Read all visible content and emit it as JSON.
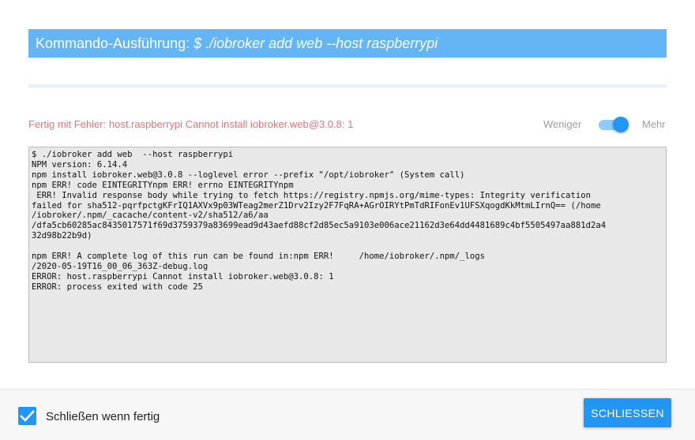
{
  "dialog": {
    "title_prefix": "Kommando-Ausführung: ",
    "title_command": "$ ./iobroker add web --host raspberrypi",
    "status": "Fertig mit Fehler: host.raspberrypi Cannot install iobroker.web@3.0.8: 1",
    "toggle": {
      "left_label": "Weniger",
      "right_label": "Mehr",
      "state": "on"
    },
    "log_lines": [
      "$ ./iobroker add web  --host raspberrypi",
      "NPM version: 6.14.4",
      "npm install iobroker.web@3.0.8 --loglevel error --prefix \"/opt/iobroker\" (System call)",
      "npm ERR! code EINTEGRITYnpm ERR! errno EINTEGRITYnpm",
      " ERR! Invalid response body while trying to fetch https://registry.npmjs.org/mime-types: Integrity verification",
      "failed for sha512-pqrfpctgKFrIQ1AXVx9p03WTeag2merZ1Drv2Izy2F7FqRA+AGrOIRYtPmTdRIFonEv1UFSXqogdKkMtmLIrnQ== (/home",
      "/iobroker/.npm/_cacache/content-v2/sha512/a6/aa",
      "/dfa5cb60285ac8435017571f69d3759379a83699ead9d43aefd88cf2d85ec5a9103e006ace21162d3e64dd4481689c4bf5505497aa881d2a4",
      "32d98b22b9d)",
      "",
      "npm ERR! A complete log of this run can be found in:npm ERR!     /home/iobroker/.npm/_logs",
      "/2020-05-19T16_00_06_363Z-debug.log",
      "ERROR: host.raspberrypi Cannot install iobroker.web@3.0.8: 1",
      "ERROR: process exited with code 25"
    ],
    "footer": {
      "checkbox_label": "Schließen wenn fertig",
      "checkbox_checked": true,
      "close_button": "SCHLIESSEN"
    },
    "colors": {
      "accent": "#2196f3",
      "title_bg": "#64b5f6",
      "error": "#e57373"
    }
  }
}
